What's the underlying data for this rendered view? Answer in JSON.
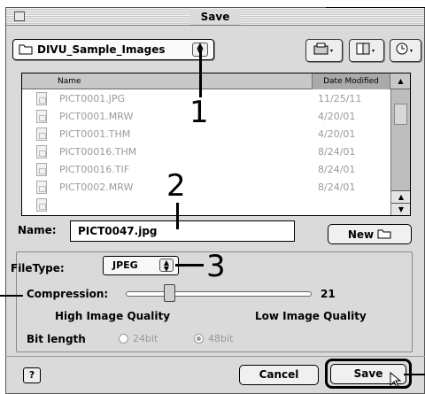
{
  "window": {
    "title": "Save"
  },
  "toolbar": {
    "folder_popup": "DIVU_Sample_Images",
    "folder_arrows": "▲▼",
    "volume_button_icon": "disk-icon",
    "desktop_button_icon": "document-icon",
    "recent_button_icon": "clock-icon"
  },
  "file_list": {
    "header_name": "Name",
    "header_date": "Date Modified",
    "sort_glyph": "▲",
    "rows": [
      {
        "name": "PICT0001.JPG",
        "date": "11/25/11"
      },
      {
        "name": "PICT0001.MRW",
        "date": "4/20/01"
      },
      {
        "name": "PICT0001.THM",
        "date": "4/20/01"
      },
      {
        "name": "PICT00016.THM",
        "date": "8/24/01"
      },
      {
        "name": "PICT00016.TIF",
        "date": "8/24/01"
      },
      {
        "name": "PICT0002.MRW",
        "date": "8/24/01"
      }
    ]
  },
  "name_field": {
    "label": "Name:",
    "value": "PICT0047.jpg"
  },
  "new_button": {
    "label": "New"
  },
  "options": {
    "filetype_label": "FileType:",
    "filetype_value": "JPEG",
    "compression_label": "Compression:",
    "compression_value": "21",
    "compression_fraction": 0.25,
    "high_quality_label": "High Image Quality",
    "low_quality_label": "Low Image Quality",
    "bit_length_label": "Bit length",
    "bit_24_label": "24bit",
    "bit_48_label": "48bit",
    "selected_bit": "48bit"
  },
  "buttons": {
    "help": "?",
    "cancel": "Cancel",
    "save": "Save"
  },
  "callouts": [
    "1",
    "2",
    "3"
  ],
  "colors": {
    "dialog_bg": "#dadada",
    "list_text_disabled": "#9a9a9a"
  }
}
